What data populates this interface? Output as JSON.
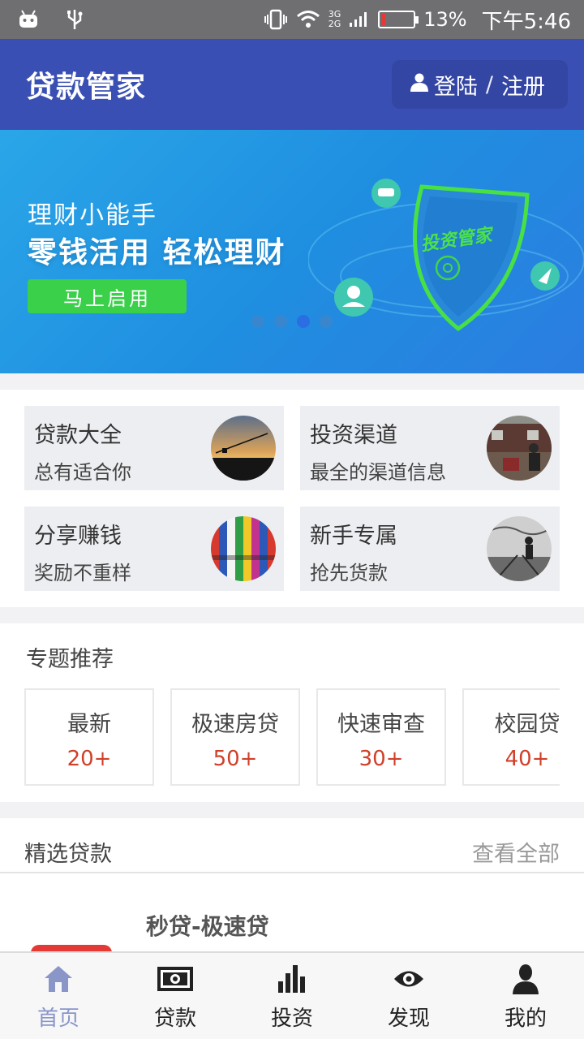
{
  "status_bar": {
    "net_top": "3G",
    "net_bottom": "2G",
    "battery": "13%",
    "battery_level": 0.13,
    "time": "下午5:46",
    "icons": [
      "android-icon",
      "usb-icon",
      "vibrate-icon",
      "wifi-icon",
      "signal-icon",
      "battery-icon"
    ]
  },
  "header": {
    "title": "贷款管家",
    "login": "登陆",
    "separator": "/",
    "register": "注册"
  },
  "banner": {
    "subtitle": "理财小能手",
    "headline": "零钱活用 轻松理财",
    "button": "马上启用",
    "shield_text": "投资管家",
    "page_count": 4,
    "active_page": 3
  },
  "quick_entries": [
    {
      "title": "贷款大全",
      "subtitle": "总有适合你"
    },
    {
      "title": "投资渠道",
      "subtitle": "最全的渠道信息"
    },
    {
      "title": "分享赚钱",
      "subtitle": "奖励不重样"
    },
    {
      "title": "新手专属",
      "subtitle": "抢先货款"
    }
  ],
  "topics": {
    "title": "专题推荐",
    "items": [
      {
        "name": "最新",
        "count": "20+"
      },
      {
        "name": "极速房贷",
        "count": "50+"
      },
      {
        "name": "快速审查",
        "count": "30+"
      },
      {
        "name": "校园贷",
        "count": "40+"
      }
    ]
  },
  "featured": {
    "title": "精选贷款",
    "more": "查看全部",
    "first_loan": "秒贷-极速贷"
  },
  "tabs": [
    {
      "label": "首页",
      "icon": "home-icon",
      "active": true
    },
    {
      "label": "贷款",
      "icon": "cash-icon",
      "active": false
    },
    {
      "label": "投资",
      "icon": "bar-chart-icon",
      "active": false
    },
    {
      "label": "发现",
      "icon": "eye-icon",
      "active": false
    },
    {
      "label": "我的",
      "icon": "person-icon",
      "active": false
    }
  ],
  "colors": {
    "primary": "#3a4fb3",
    "accent_green": "#3ad04a",
    "count_red": "#d0402a",
    "tab_active": "#8a96c8"
  }
}
